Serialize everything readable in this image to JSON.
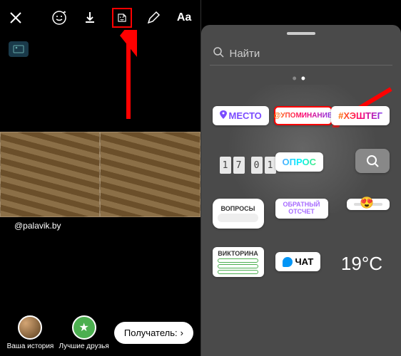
{
  "left": {
    "tag_handle": "@palavik.by",
    "your_story": "Ваша история",
    "close_friends": "Лучшие друзья",
    "recipient": "Получатель:"
  },
  "right": {
    "search_placeholder": "Найти",
    "stickers": {
      "location": "МЕСТО",
      "mention": "@УПОМИНАНИЕ",
      "hashtag": "#ХЭШТЕГ",
      "time_digits": [
        "1",
        "7",
        "0",
        "1"
      ],
      "poll": "ОПРОС",
      "questions": "ВОПРОСЫ",
      "countdown": "ОБРАТНЫЙ ОТСЧЕТ",
      "quiz": "ВИКТОРИНА",
      "chat": "ЧАТ",
      "weather": "19°C"
    }
  }
}
